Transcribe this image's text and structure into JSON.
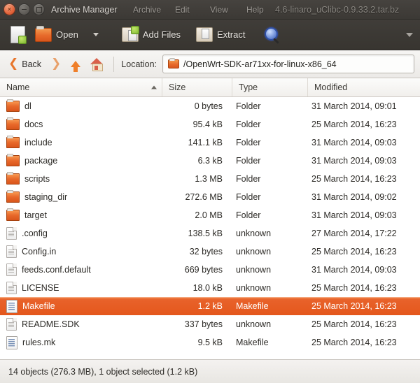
{
  "window": {
    "title": "Archive Manager",
    "ghost_title_full": "Archive Manager 7 Archive  Edit  View  Help 4.6-linaro_uClibc-0.9.33.2.tar.bz",
    "archive_name": "4.6-linaro_uClibc-0.9.33.2.tar.bz",
    "menu": [
      "Archive",
      "Edit",
      "View",
      "Help"
    ],
    "controls": {
      "close": "close-button",
      "minimize": "minimize-button",
      "maximize": "maximize-button"
    }
  },
  "toolbar": {
    "new_icon": "new-archive-icon",
    "open_label": "Open",
    "open_icon": "open-folder-icon",
    "open_dropdown_icon": "chevron-down-icon",
    "add_files_label": "Add Files",
    "add_files_icon": "add-files-icon",
    "extract_label": "Extract",
    "extract_icon": "extract-icon",
    "search_icon": "search-icon",
    "overflow_icon": "toolbar-overflow-icon"
  },
  "navbar": {
    "back_label": "Back",
    "back_icon": "chevron-left-icon",
    "forward_icon": "chevron-right-icon",
    "up_icon": "arrow-up-icon",
    "home_icon": "home-icon",
    "location_label": "Location:",
    "location_value": "/OpenWrt-SDK-ar71xx-for-linux-x86_64",
    "location_icon": "folder-icon"
  },
  "filelist": {
    "columns": [
      {
        "key": "name",
        "label": "Name",
        "sorted": true,
        "sort_dir": "ascending"
      },
      {
        "key": "size",
        "label": "Size",
        "sorted": false
      },
      {
        "key": "type",
        "label": "Type",
        "sorted": false
      },
      {
        "key": "modified",
        "label": "Modified",
        "sorted": false
      }
    ],
    "rows": [
      {
        "icon": "folder-icon",
        "name": "dl",
        "size": "0 bytes",
        "type": "Folder",
        "modified": "31 March 2014, 09:01",
        "selected": false
      },
      {
        "icon": "folder-icon",
        "name": "docs",
        "size": "95.4 kB",
        "type": "Folder",
        "modified": "25 March 2014, 16:23",
        "selected": false
      },
      {
        "icon": "folder-icon",
        "name": "include",
        "size": "141.1 kB",
        "type": "Folder",
        "modified": "31 March 2014, 09:03",
        "selected": false
      },
      {
        "icon": "folder-icon",
        "name": "package",
        "size": "6.3 kB",
        "type": "Folder",
        "modified": "31 March 2014, 09:03",
        "selected": false
      },
      {
        "icon": "folder-icon",
        "name": "scripts",
        "size": "1.3 MB",
        "type": "Folder",
        "modified": "25 March 2014, 16:23",
        "selected": false
      },
      {
        "icon": "folder-icon",
        "name": "staging_dir",
        "size": "272.6 MB",
        "type": "Folder",
        "modified": "31 March 2014, 09:02",
        "selected": false
      },
      {
        "icon": "folder-icon",
        "name": "target",
        "size": "2.0 MB",
        "type": "Folder",
        "modified": "31 March 2014, 09:03",
        "selected": false
      },
      {
        "icon": "unknown-file-icon",
        "name": ".config",
        "size": "138.5 kB",
        "type": "unknown",
        "modified": "27 March 2014, 17:22",
        "selected": false
      },
      {
        "icon": "unknown-file-icon",
        "name": "Config.in",
        "size": "32 bytes",
        "type": "unknown",
        "modified": "25 March 2014, 16:23",
        "selected": false
      },
      {
        "icon": "unknown-file-icon",
        "name": "feeds.conf.default",
        "size": "669 bytes",
        "type": "unknown",
        "modified": "31 March 2014, 09:03",
        "selected": false
      },
      {
        "icon": "unknown-file-icon",
        "name": "LICENSE",
        "size": "18.0 kB",
        "type": "unknown",
        "modified": "25 March 2014, 16:23",
        "selected": false
      },
      {
        "icon": "makefile-icon",
        "name": "Makefile",
        "size": "1.2 kB",
        "type": "Makefile",
        "modified": "25 March 2014, 16:23",
        "selected": true
      },
      {
        "icon": "unknown-file-icon",
        "name": "README.SDK",
        "size": "337 bytes",
        "type": "unknown",
        "modified": "25 March 2014, 16:23",
        "selected": false
      },
      {
        "icon": "makefile-icon",
        "name": "rules.mk",
        "size": "9.5 kB",
        "type": "Makefile",
        "modified": "25 March 2014, 16:23",
        "selected": false
      }
    ]
  },
  "statusbar": {
    "text": "14 objects (276.3 MB), 1 object selected (1.2 kB)"
  },
  "colors": {
    "selection": "#e8622a",
    "titlebar": "#3c3935",
    "toolbar": "#383530",
    "accent_orange": "#ef7f2a"
  }
}
